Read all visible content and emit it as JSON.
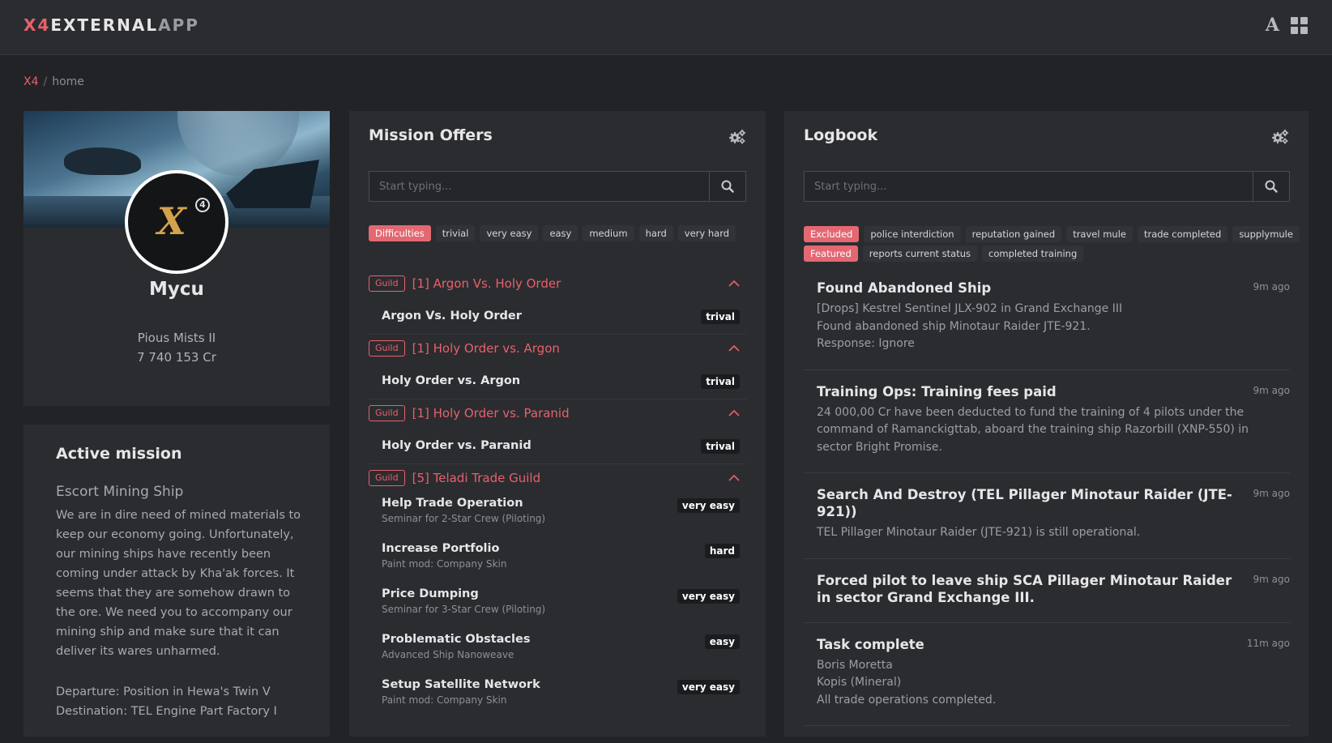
{
  "app": {
    "brand_a": "X4",
    "brand_b": "EXTERNAL",
    "brand_c": "APP",
    "font_icon_glyph": "A"
  },
  "breadcrumb": {
    "root": "X4",
    "sep": "/",
    "current": "home"
  },
  "profile": {
    "name": "Mycu",
    "sector": "Pious Mists II",
    "credits": "7 740 153 Cr",
    "logo_text": "X",
    "logo_sup": "4"
  },
  "active_mission": {
    "heading": "Active mission",
    "title": "Escort Mining Ship",
    "description": "We are in dire need of mined materials to keep our economy going. Unfortunately, our mining ships have recently been coming under attack by Kha'ak forces. It seems that they are somehow drawn to the ore. We need you to accompany our mining ship and make sure that it can deliver its wares unharmed.",
    "departure": "Departure: Position in Hewa's Twin V",
    "destination": "Destination: TEL Engine Part Factory I"
  },
  "missions": {
    "title": "Mission Offers",
    "search_placeholder": "Start typing...",
    "filter_label": "Difficulties",
    "difficulties": [
      "trivial",
      "very easy",
      "easy",
      "medium",
      "hard",
      "very hard"
    ],
    "groups": [
      {
        "tag": "Guild",
        "title": "[1] Argon Vs. Holy Order",
        "items": [
          {
            "name": "Argon Vs. Holy Order",
            "badge": "trival"
          }
        ]
      },
      {
        "tag": "Guild",
        "title": "[1] Holy Order vs. Argon",
        "items": [
          {
            "name": "Holy Order vs. Argon",
            "badge": "trival"
          }
        ]
      },
      {
        "tag": "Guild",
        "title": "[1] Holy Order vs. Paranid",
        "items": [
          {
            "name": "Holy Order vs. Paranid",
            "badge": "trival"
          }
        ]
      },
      {
        "tag": "Guild",
        "title": "[5] Teladi Trade Guild",
        "items": [
          {
            "name": "Help Trade Operation",
            "sub": "Seminar for 2-Star Crew (Piloting)",
            "badge": "very easy"
          },
          {
            "name": "Increase Portfolio",
            "sub": "Paint mod: Company Skin",
            "badge": "hard"
          },
          {
            "name": "Price Dumping",
            "sub": "Seminar for 3-Star Crew (Piloting)",
            "badge": "very easy"
          },
          {
            "name": "Problematic Obstacles",
            "sub": "Advanced Ship Nanoweave",
            "badge": "easy"
          },
          {
            "name": "Setup Satellite Network",
            "sub": "Paint mod: Company Skin",
            "badge": "very easy"
          }
        ]
      }
    ]
  },
  "logbook": {
    "title": "Logbook",
    "search_placeholder": "Start typing...",
    "excluded_label": "Excluded",
    "excluded": [
      "police interdiction",
      "reputation gained",
      "travel mule",
      "trade completed",
      "supplymule"
    ],
    "featured_label": "Featured",
    "featured": [
      "reports current status",
      "completed training"
    ],
    "entries": [
      {
        "title": "Found Abandoned Ship",
        "time": "9m ago",
        "body": [
          "[Drops] Kestrel Sentinel JLX-902 in Grand Exchange III",
          "Found abandoned ship Minotaur Raider JTE-921.",
          "Response: Ignore"
        ]
      },
      {
        "title": "Training Ops: Training fees paid",
        "time": "9m ago",
        "body": [
          "24 000,00 Cr have been deducted to fund the training of 4 pilots under the command of Ramanckigttab, aboard the training ship Razorbill (XNP-550) in sector Bright Promise."
        ]
      },
      {
        "title": "Search And Destroy (TEL Pillager Minotaur Raider (JTE-921))",
        "time": "9m ago",
        "body": [
          "TEL Pillager Minotaur Raider (JTE-921) is still operational."
        ]
      },
      {
        "title": "Forced pilot to leave ship SCA Pillager Minotaur Raider in sector Grand Exchange III.",
        "time": "9m ago",
        "body": []
      },
      {
        "title": "Task complete",
        "time": "11m ago",
        "body": [
          "Boris Moretta",
          "Kopis (Mineral)",
          "All trade operations completed."
        ]
      }
    ]
  },
  "colors": {
    "accent": "#e8616b",
    "panel": "#2b2c30",
    "background": "#222326"
  },
  "icons": [
    "font-size-icon",
    "grid-view-icon",
    "gears-icon",
    "search-icon",
    "chevron-up-icon"
  ]
}
